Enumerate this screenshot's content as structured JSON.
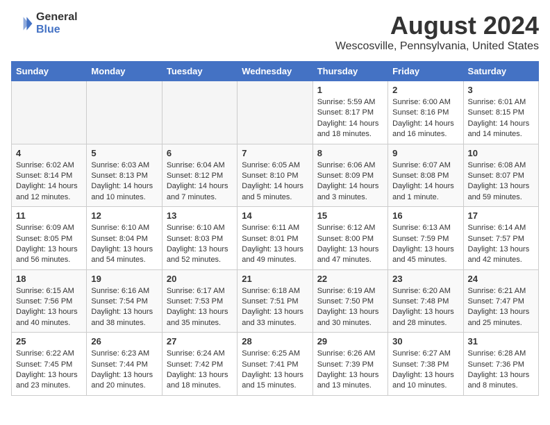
{
  "header": {
    "logo_line1": "General",
    "logo_line2": "Blue",
    "month_year": "August 2024",
    "location": "Wescosville, Pennsylvania, United States"
  },
  "weekdays": [
    "Sunday",
    "Monday",
    "Tuesday",
    "Wednesday",
    "Thursday",
    "Friday",
    "Saturday"
  ],
  "weeks": [
    [
      {
        "day": "",
        "empty": true
      },
      {
        "day": "",
        "empty": true
      },
      {
        "day": "",
        "empty": true
      },
      {
        "day": "",
        "empty": true
      },
      {
        "day": "1",
        "sunrise": "Sunrise: 5:59 AM",
        "sunset": "Sunset: 8:17 PM",
        "daylight": "Daylight: 14 hours and 18 minutes."
      },
      {
        "day": "2",
        "sunrise": "Sunrise: 6:00 AM",
        "sunset": "Sunset: 8:16 PM",
        "daylight": "Daylight: 14 hours and 16 minutes."
      },
      {
        "day": "3",
        "sunrise": "Sunrise: 6:01 AM",
        "sunset": "Sunset: 8:15 PM",
        "daylight": "Daylight: 14 hours and 14 minutes."
      }
    ],
    [
      {
        "day": "4",
        "sunrise": "Sunrise: 6:02 AM",
        "sunset": "Sunset: 8:14 PM",
        "daylight": "Daylight: 14 hours and 12 minutes."
      },
      {
        "day": "5",
        "sunrise": "Sunrise: 6:03 AM",
        "sunset": "Sunset: 8:13 PM",
        "daylight": "Daylight: 14 hours and 10 minutes."
      },
      {
        "day": "6",
        "sunrise": "Sunrise: 6:04 AM",
        "sunset": "Sunset: 8:12 PM",
        "daylight": "Daylight: 14 hours and 7 minutes."
      },
      {
        "day": "7",
        "sunrise": "Sunrise: 6:05 AM",
        "sunset": "Sunset: 8:10 PM",
        "daylight": "Daylight: 14 hours and 5 minutes."
      },
      {
        "day": "8",
        "sunrise": "Sunrise: 6:06 AM",
        "sunset": "Sunset: 8:09 PM",
        "daylight": "Daylight: 14 hours and 3 minutes."
      },
      {
        "day": "9",
        "sunrise": "Sunrise: 6:07 AM",
        "sunset": "Sunset: 8:08 PM",
        "daylight": "Daylight: 14 hours and 1 minute."
      },
      {
        "day": "10",
        "sunrise": "Sunrise: 6:08 AM",
        "sunset": "Sunset: 8:07 PM",
        "daylight": "Daylight: 13 hours and 59 minutes."
      }
    ],
    [
      {
        "day": "11",
        "sunrise": "Sunrise: 6:09 AM",
        "sunset": "Sunset: 8:05 PM",
        "daylight": "Daylight: 13 hours and 56 minutes."
      },
      {
        "day": "12",
        "sunrise": "Sunrise: 6:10 AM",
        "sunset": "Sunset: 8:04 PM",
        "daylight": "Daylight: 13 hours and 54 minutes."
      },
      {
        "day": "13",
        "sunrise": "Sunrise: 6:10 AM",
        "sunset": "Sunset: 8:03 PM",
        "daylight": "Daylight: 13 hours and 52 minutes."
      },
      {
        "day": "14",
        "sunrise": "Sunrise: 6:11 AM",
        "sunset": "Sunset: 8:01 PM",
        "daylight": "Daylight: 13 hours and 49 minutes."
      },
      {
        "day": "15",
        "sunrise": "Sunrise: 6:12 AM",
        "sunset": "Sunset: 8:00 PM",
        "daylight": "Daylight: 13 hours and 47 minutes."
      },
      {
        "day": "16",
        "sunrise": "Sunrise: 6:13 AM",
        "sunset": "Sunset: 7:59 PM",
        "daylight": "Daylight: 13 hours and 45 minutes."
      },
      {
        "day": "17",
        "sunrise": "Sunrise: 6:14 AM",
        "sunset": "Sunset: 7:57 PM",
        "daylight": "Daylight: 13 hours and 42 minutes."
      }
    ],
    [
      {
        "day": "18",
        "sunrise": "Sunrise: 6:15 AM",
        "sunset": "Sunset: 7:56 PM",
        "daylight": "Daylight: 13 hours and 40 minutes."
      },
      {
        "day": "19",
        "sunrise": "Sunrise: 6:16 AM",
        "sunset": "Sunset: 7:54 PM",
        "daylight": "Daylight: 13 hours and 38 minutes."
      },
      {
        "day": "20",
        "sunrise": "Sunrise: 6:17 AM",
        "sunset": "Sunset: 7:53 PM",
        "daylight": "Daylight: 13 hours and 35 minutes."
      },
      {
        "day": "21",
        "sunrise": "Sunrise: 6:18 AM",
        "sunset": "Sunset: 7:51 PM",
        "daylight": "Daylight: 13 hours and 33 minutes."
      },
      {
        "day": "22",
        "sunrise": "Sunrise: 6:19 AM",
        "sunset": "Sunset: 7:50 PM",
        "daylight": "Daylight: 13 hours and 30 minutes."
      },
      {
        "day": "23",
        "sunrise": "Sunrise: 6:20 AM",
        "sunset": "Sunset: 7:48 PM",
        "daylight": "Daylight: 13 hours and 28 minutes."
      },
      {
        "day": "24",
        "sunrise": "Sunrise: 6:21 AM",
        "sunset": "Sunset: 7:47 PM",
        "daylight": "Daylight: 13 hours and 25 minutes."
      }
    ],
    [
      {
        "day": "25",
        "sunrise": "Sunrise: 6:22 AM",
        "sunset": "Sunset: 7:45 PM",
        "daylight": "Daylight: 13 hours and 23 minutes."
      },
      {
        "day": "26",
        "sunrise": "Sunrise: 6:23 AM",
        "sunset": "Sunset: 7:44 PM",
        "daylight": "Daylight: 13 hours and 20 minutes."
      },
      {
        "day": "27",
        "sunrise": "Sunrise: 6:24 AM",
        "sunset": "Sunset: 7:42 PM",
        "daylight": "Daylight: 13 hours and 18 minutes."
      },
      {
        "day": "28",
        "sunrise": "Sunrise: 6:25 AM",
        "sunset": "Sunset: 7:41 PM",
        "daylight": "Daylight: 13 hours and 15 minutes."
      },
      {
        "day": "29",
        "sunrise": "Sunrise: 6:26 AM",
        "sunset": "Sunset: 7:39 PM",
        "daylight": "Daylight: 13 hours and 13 minutes."
      },
      {
        "day": "30",
        "sunrise": "Sunrise: 6:27 AM",
        "sunset": "Sunset: 7:38 PM",
        "daylight": "Daylight: 13 hours and 10 minutes."
      },
      {
        "day": "31",
        "sunrise": "Sunrise: 6:28 AM",
        "sunset": "Sunset: 7:36 PM",
        "daylight": "Daylight: 13 hours and 8 minutes."
      }
    ]
  ]
}
